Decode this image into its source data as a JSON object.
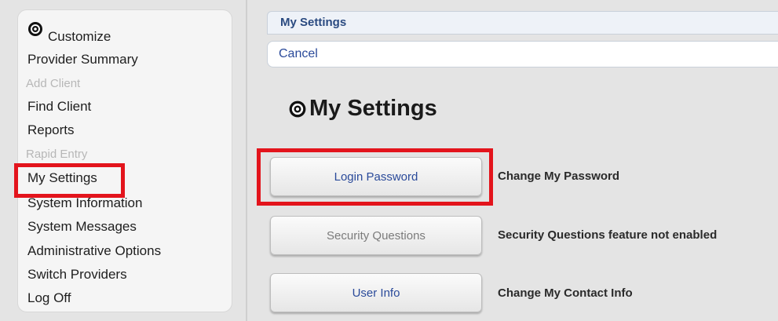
{
  "sidebar": {
    "items": [
      {
        "label": "Customize",
        "enabled": true
      },
      {
        "label": "Provider Summary",
        "enabled": true
      },
      {
        "label": "Add Client",
        "enabled": false
      },
      {
        "label": "Find Client",
        "enabled": true
      },
      {
        "label": "Reports",
        "enabled": true
      },
      {
        "label": "Rapid Entry",
        "enabled": false
      },
      {
        "label": "My Settings",
        "enabled": true
      },
      {
        "label": "System Information",
        "enabled": true
      },
      {
        "label": "System Messages",
        "enabled": true
      },
      {
        "label": "Administrative Options",
        "enabled": true
      },
      {
        "label": "Switch Providers",
        "enabled": true
      },
      {
        "label": "Log Off",
        "enabled": true
      }
    ]
  },
  "header": {
    "title": "My Settings"
  },
  "actions": {
    "cancel_label": "Cancel"
  },
  "page": {
    "title": "My Settings"
  },
  "settings": [
    {
      "button_label": "Login Password",
      "description": "Change My Password",
      "enabled": true
    },
    {
      "button_label": "Security Questions",
      "description": "Security Questions feature not enabled",
      "enabled": false
    },
    {
      "button_label": "User Info",
      "description": "Change My Contact Info",
      "enabled": true
    }
  ],
  "colors": {
    "highlight": "#e3141c",
    "link": "#2a4a9a",
    "header_text": "#2a4a80"
  }
}
